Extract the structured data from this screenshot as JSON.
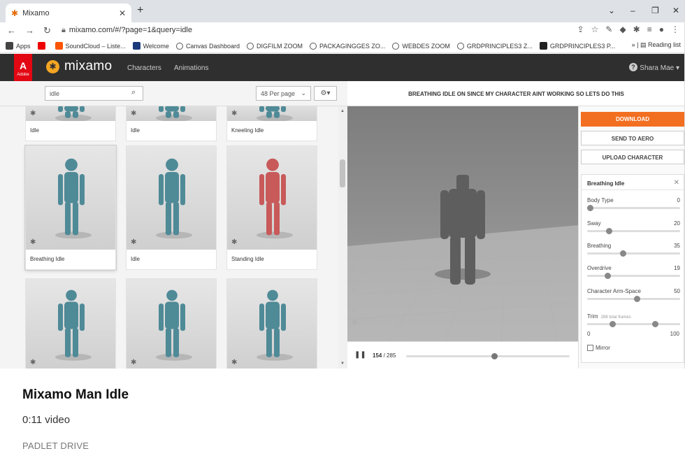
{
  "browser": {
    "tab_title": "Mixamo",
    "url": "mixamo.com/#/?page=1&query=idle",
    "bookmarks": [
      {
        "label": "Apps",
        "color": "#444"
      },
      {
        "label": "",
        "color": "#e00"
      },
      {
        "label": "SoundCloud – Liste...",
        "color": "#f50"
      },
      {
        "label": "Welcome",
        "color": "#1a3a7a"
      },
      {
        "label": "Canvas Dashboard",
        "color": ""
      },
      {
        "label": "DIGFILM ZOOM",
        "color": ""
      },
      {
        "label": "PACKAGINGGES ZO...",
        "color": ""
      },
      {
        "label": "WEBDES ZOOM",
        "color": ""
      },
      {
        "label": "GRDPRINCIPLES3 Z...",
        "color": ""
      },
      {
        "label": "GRDPRINCIPLES3 P...",
        "color": "#222"
      }
    ],
    "reading_list": "Reading list"
  },
  "mixamo": {
    "brand": "mixamo",
    "adobe": "Adobe",
    "nav_characters": "Characters",
    "nav_animations": "Animations",
    "user": "Shara Mae ▾"
  },
  "library": {
    "search_value": "idle",
    "per_page": "48 Per page",
    "cards": [
      {
        "label": "Idle",
        "color": "#4f8a97"
      },
      {
        "label": "Idle",
        "color": "#4f8a97"
      },
      {
        "label": "Kneeling Idle",
        "color": "#4f8a97"
      },
      {
        "label": "Breathing Idle",
        "color": "#4f8a97",
        "selected": true
      },
      {
        "label": "Idle",
        "color": "#4f8a97"
      },
      {
        "label": "Standing Idle",
        "color": "#c85a5a"
      },
      {
        "label": "",
        "color": "#4f8a97"
      },
      {
        "label": "",
        "color": "#4f8a97"
      },
      {
        "label": "",
        "color": "#4f8a97"
      }
    ]
  },
  "viewer": {
    "title": "BREATHING IDLE ON SINCE MY CHARACTER AINT WORKING SO LETS DO THIS",
    "frame_current": "154",
    "frame_total": "/ 285",
    "playback_fraction": 0.54
  },
  "panel": {
    "download": "DOWNLOAD",
    "send_to_aero": "SEND TO AERO",
    "upload_character": "UPLOAD CHARACTER",
    "settings_title": "Breathing Idle",
    "params": [
      {
        "name": "Body Type",
        "value": "0",
        "fraction": 0.0
      },
      {
        "name": "Sway",
        "value": "20",
        "fraction": 0.2
      },
      {
        "name": "Breathing",
        "value": "35",
        "fraction": 0.35
      },
      {
        "name": "Overdrive",
        "value": "19",
        "fraction": 0.19
      },
      {
        "name": "Character Arm-Space",
        "value": "50",
        "fraction": 0.5
      }
    ],
    "trim_label": "Trim",
    "trim_frames": "288 total frames",
    "trim_low": "0",
    "trim_high": "100",
    "trim_start_fraction": 0.27,
    "trim_end_fraction": 0.73,
    "mirror": "Mirror"
  },
  "caption": {
    "title": "Mixamo Man Idle",
    "subtitle": "0:11 video",
    "source": "PADLET DRIVE"
  }
}
